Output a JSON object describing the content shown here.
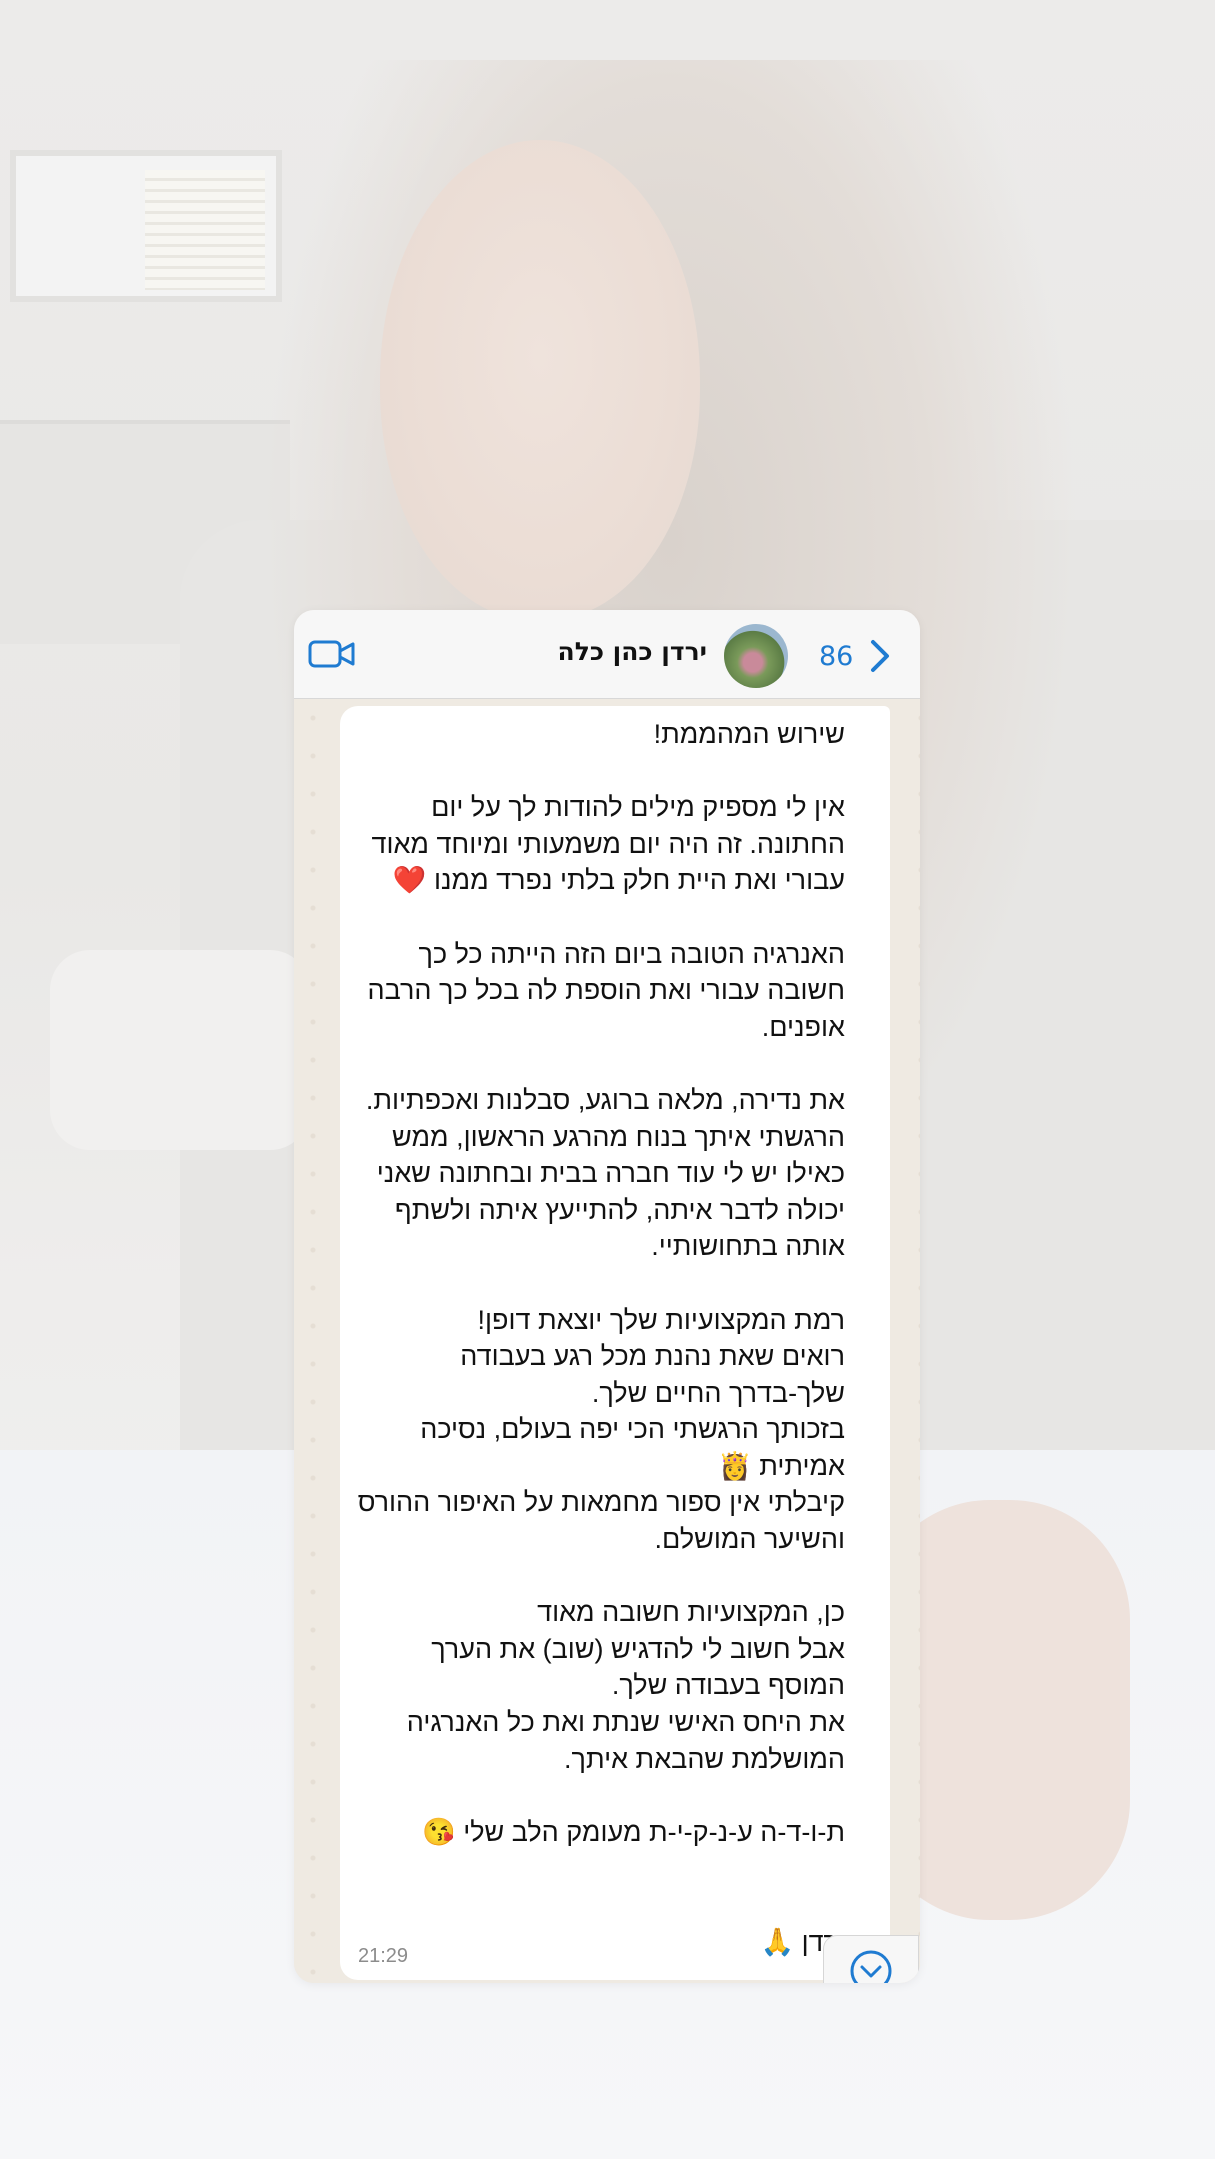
{
  "chat": {
    "contact_name": "ירדן כהן כלה",
    "unread_count": "86",
    "colors": {
      "accent": "#1f7bd1",
      "chat_bg": "#efeae2",
      "bubble": "#ffffff"
    }
  },
  "message": {
    "text": "שירוש המהממת!\n\nאין לי מספיק מילים להודות לך על יום\nהחתונה. זה היה יום משמעותי ומיוחד מאוד\nעבורי ואת היית חלק בלתי נפרד ממנו ❤️\n\nהאנרגיה הטובה ביום הזה הייתה כל כך\nחשובה עבורי ואת הוספת לה בכל כך הרבה\nאופנים.\n\nאת נדירה, מלאה ברוגע, סבלנות ואכפתיות.\nהרגשתי איתך בנוח מהרגע הראשון, ממש\nכאילו יש לי עוד חברה בבית ובחתונה שאני\nיכולה לדבר איתה, להתייעץ איתה ולשתף\nאותה בתחושותיי.\n\nרמת המקצועיות שלך יוצאת דופן!\nרואים שאת נהנת מכל רגע בעבודה\nשלך-בדרך החיים שלך.\nבזכותך הרגשתי הכי יפה בעולם, נסיכה\nאמיתית 👸\nקיבלתי אין ספור מחמאות על האיפור ההורס\nוהשיער המושלם.\n\nכן, המקצועיות חשובה מאוד\nאבל חשוב לי להדגיש (שוב) את הערך\nהמוסף בעבודה שלך.\nאת היחס האישי שנתת ואת כל האנרגיה\nהמושלמת שהבאת איתך.\n\nת-ו-ד-ה ע-נ-ק-י-ת מעומק הלב שלי 😘\n\n\nירדן 🙏",
    "time": "21:29"
  }
}
